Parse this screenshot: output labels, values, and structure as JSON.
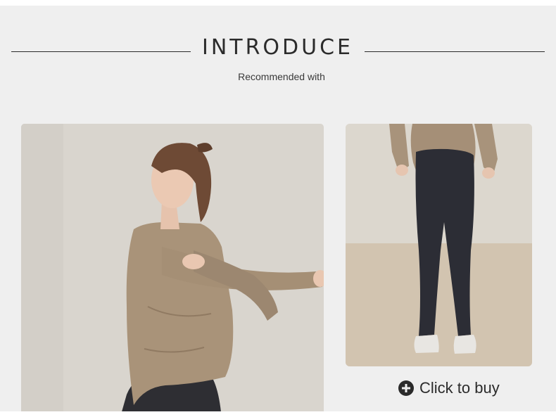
{
  "header": {
    "title": "INTRODUCE",
    "subtitle": "Recommended with"
  },
  "products": [
    {
      "image": "model-wearing-beige-long-sleeve-top-stretching"
    },
    {
      "image": "back-view-beige-split-back-top-with-dark-flare-pants"
    }
  ],
  "cta": {
    "label": "Click to buy",
    "icon": "plus-circle-icon"
  },
  "colors": {
    "background": "#efefef",
    "text": "#2b2b2b",
    "top": "#a58f77",
    "pants": "#2c2d35"
  }
}
